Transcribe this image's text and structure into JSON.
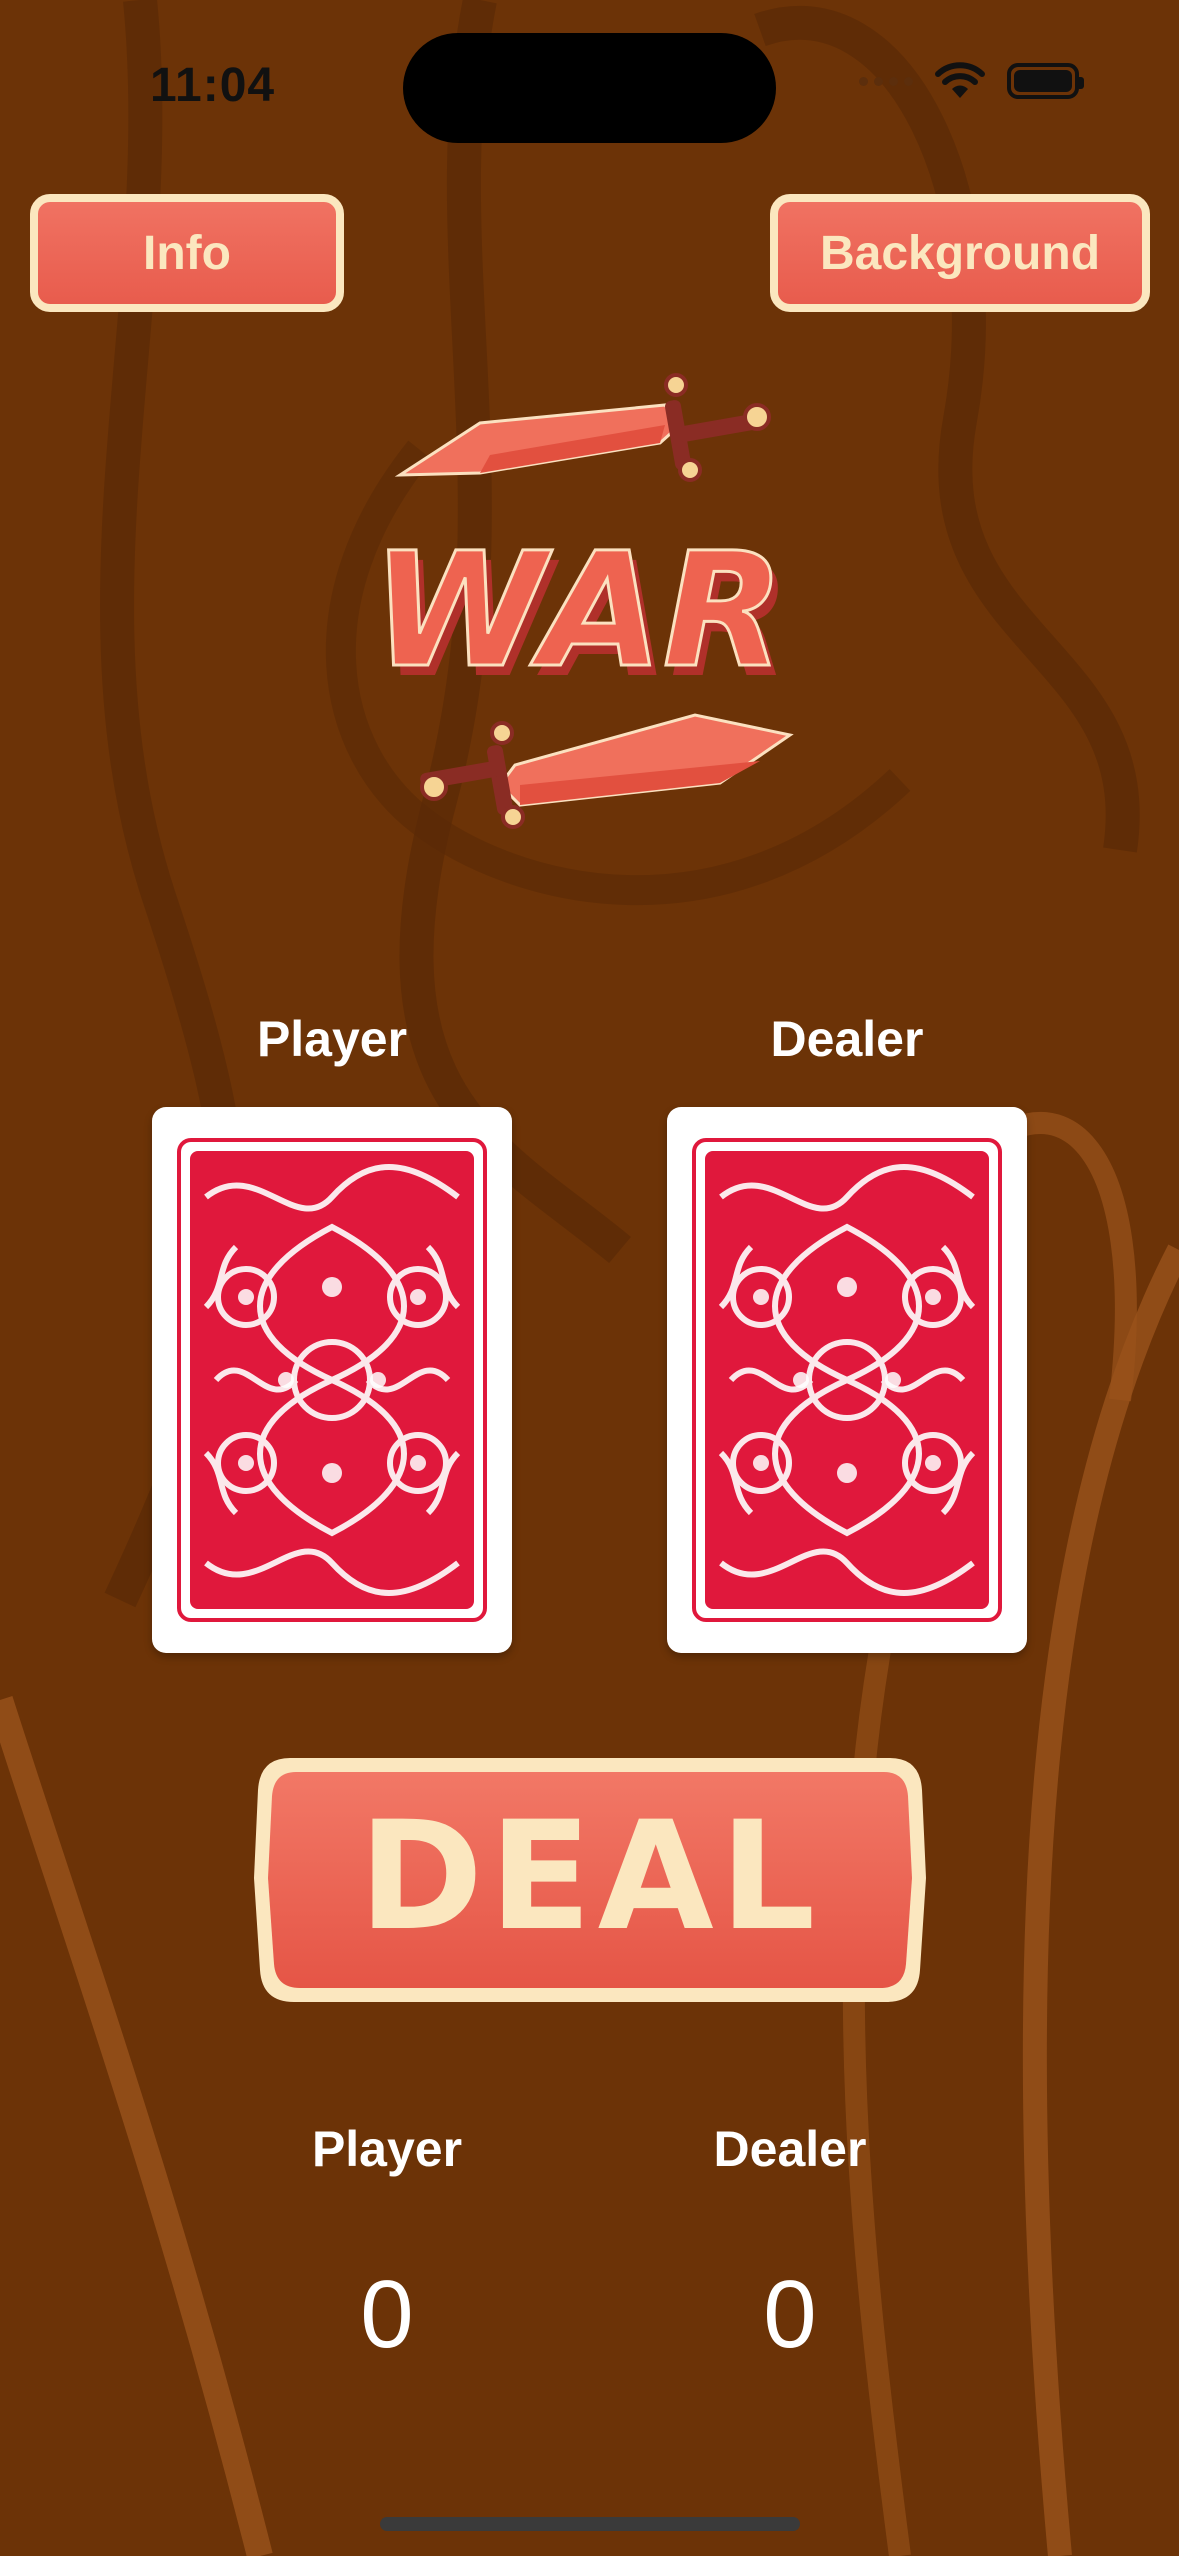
{
  "status_bar": {
    "time": "11:04"
  },
  "top_buttons": {
    "info_label": "Info",
    "background_label": "Background"
  },
  "logo": {
    "text": "WAR"
  },
  "table": {
    "player_label": "Player",
    "dealer_label": "Dealer",
    "player_card": "card-back",
    "dealer_card": "card-back"
  },
  "deal_button": {
    "label": "DEAL"
  },
  "scores": {
    "player_label": "Player",
    "dealer_label": "Dealer",
    "player_score": "0",
    "dealer_score": "0"
  },
  "colors": {
    "background": "#6e3408",
    "button_fill": "#ee6a5a",
    "button_border": "#fbe7bf",
    "card_pattern": "#e0183c"
  }
}
